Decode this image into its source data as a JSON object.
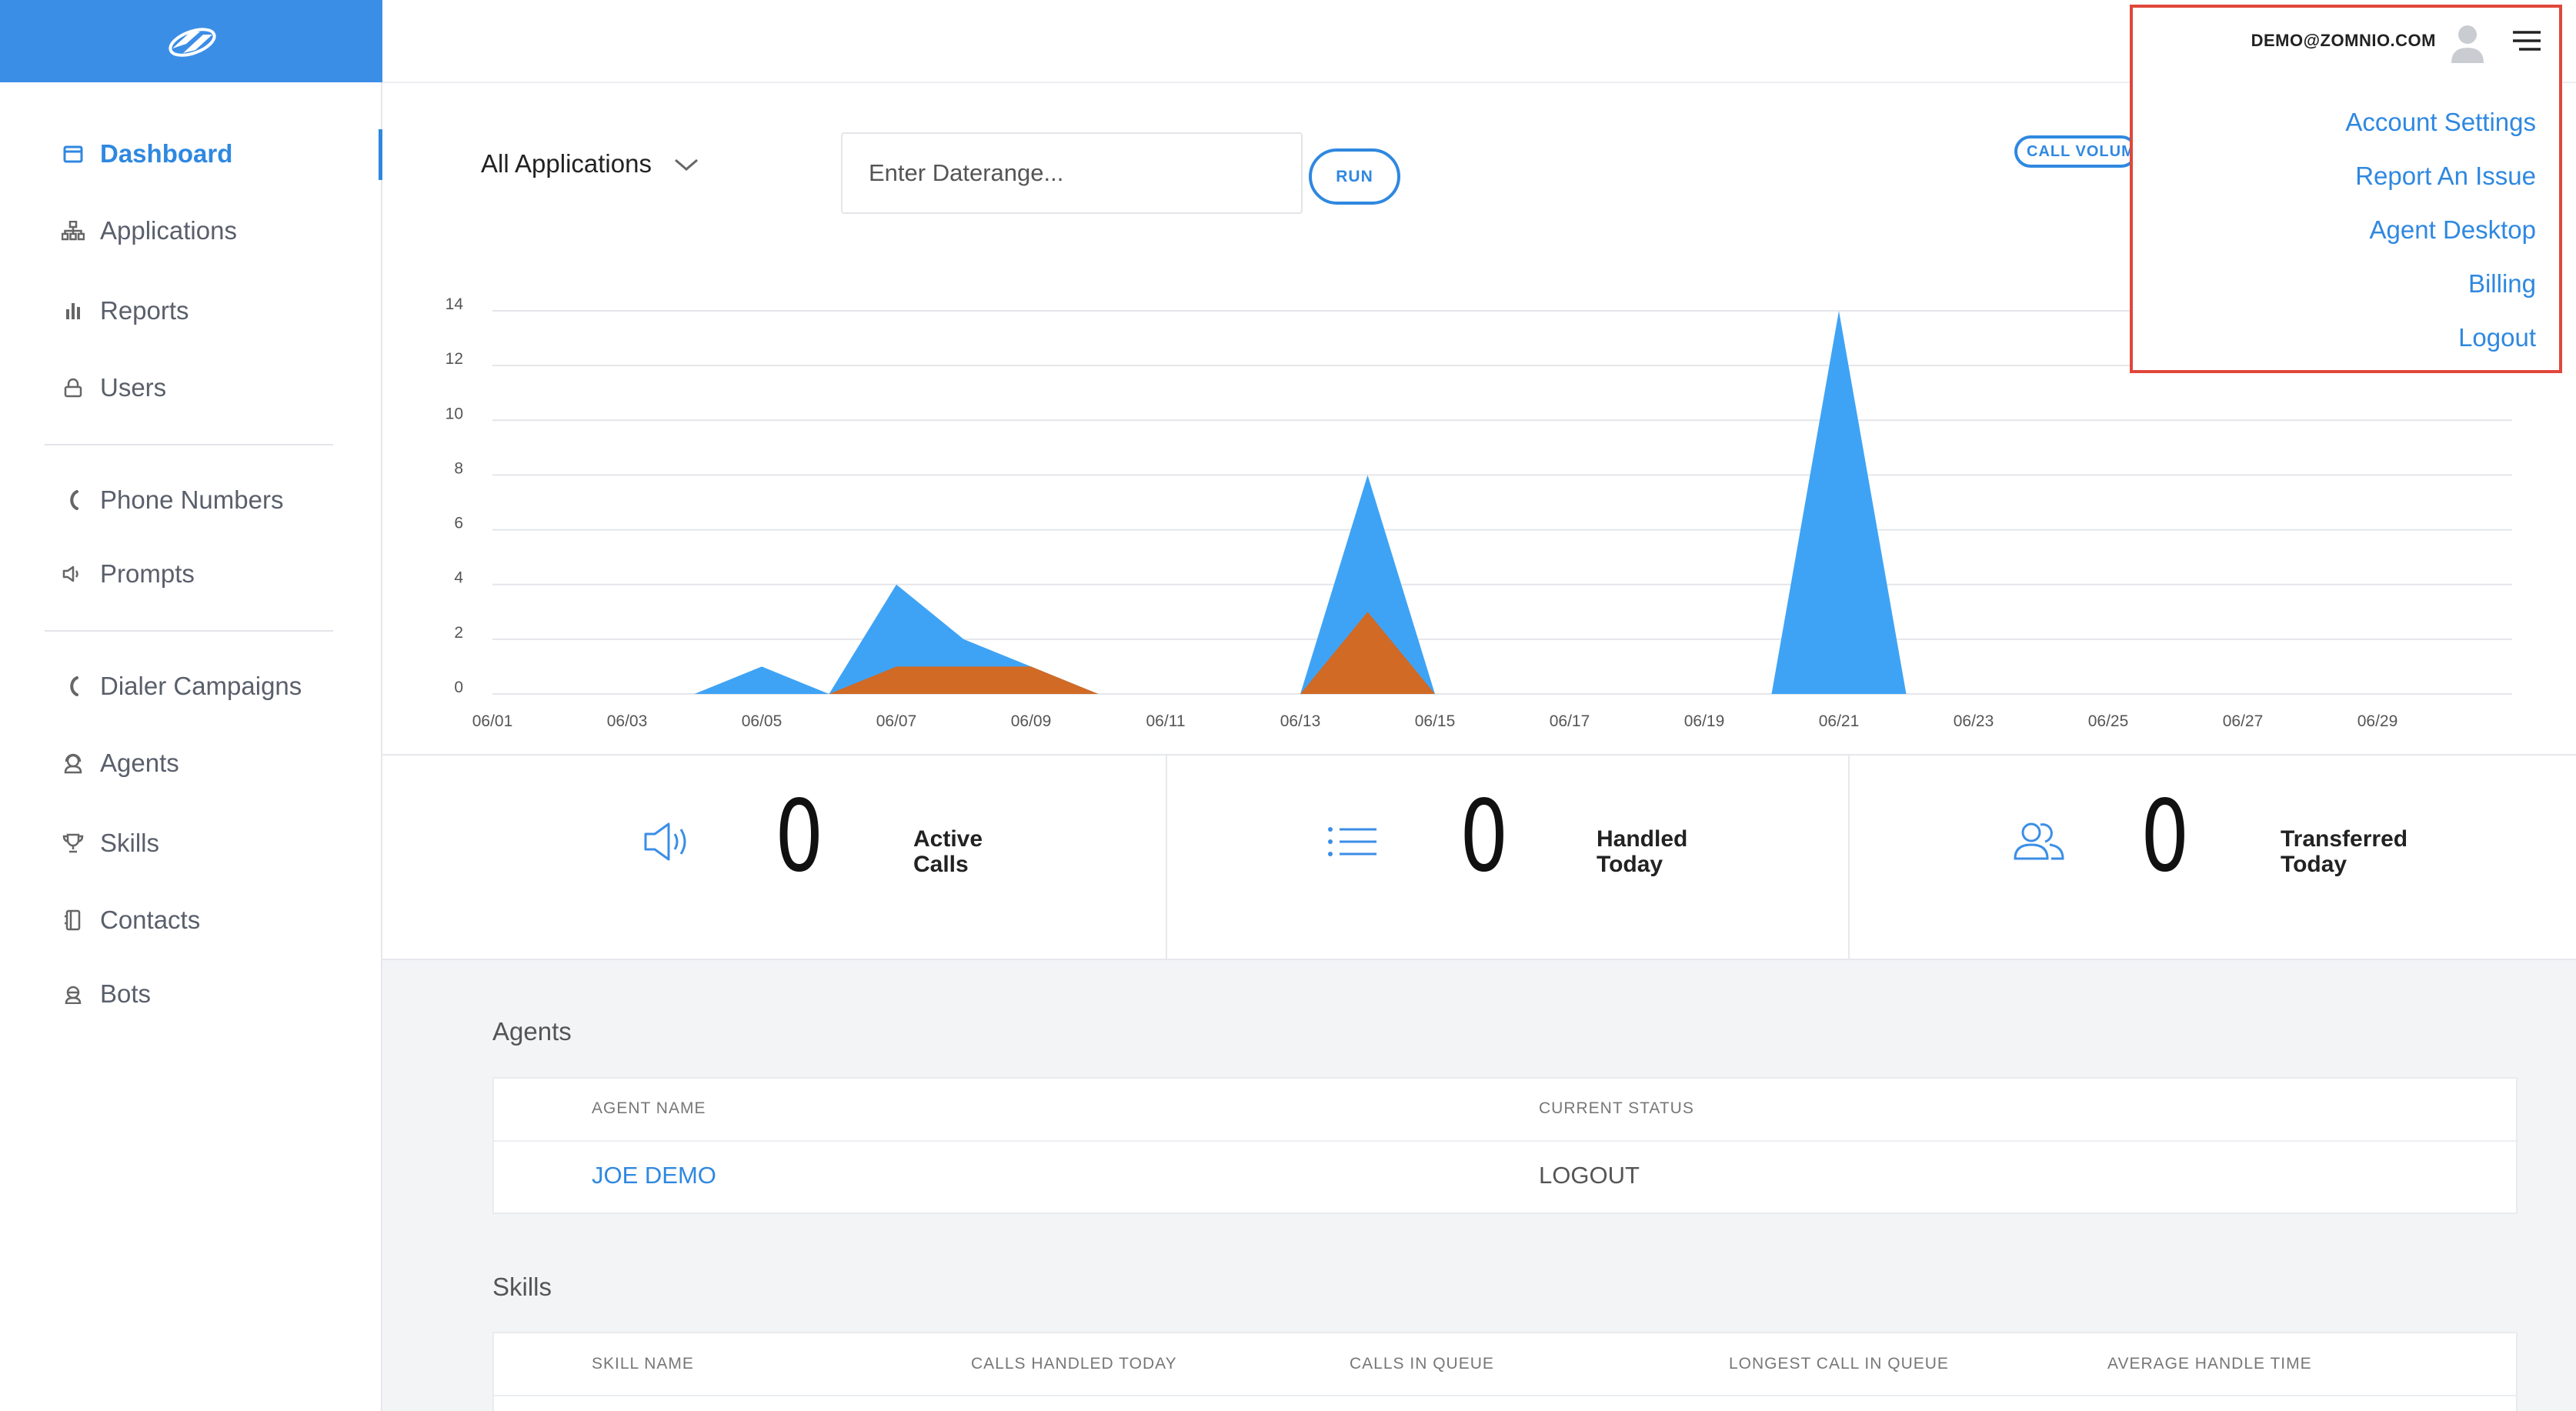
{
  "sidebar": {
    "items": [
      {
        "label": "Dashboard",
        "icon": "calendar-icon"
      },
      {
        "label": "Applications",
        "icon": "sitemap-icon"
      },
      {
        "label": "Reports",
        "icon": "bar-chart-icon"
      },
      {
        "label": "Users",
        "icon": "lock-icon"
      },
      {
        "label": "Phone Numbers",
        "icon": "phone-icon"
      },
      {
        "label": "Prompts",
        "icon": "speaker-icon"
      },
      {
        "label": "Dialer Campaigns",
        "icon": "phone-icon"
      },
      {
        "label": "Agents",
        "icon": "agent-icon"
      },
      {
        "label": "Skills",
        "icon": "trophy-icon"
      },
      {
        "label": "Contacts",
        "icon": "address-book-icon"
      },
      {
        "label": "Bots",
        "icon": "bot-icon"
      }
    ],
    "active_index": 0
  },
  "filters": {
    "application": "All Applications",
    "daterange_placeholder": "Enter Daterange...",
    "run_label": "RUN",
    "call_volume_label": "CALL VOLUM"
  },
  "chart_data": {
    "type": "area",
    "x": [
      "06/01",
      "06/02",
      "06/03",
      "06/04",
      "06/05",
      "06/06",
      "06/07",
      "06/08",
      "06/09",
      "06/10",
      "06/11",
      "06/12",
      "06/13",
      "06/14",
      "06/15",
      "06/16",
      "06/17",
      "06/18",
      "06/19",
      "06/20",
      "06/21",
      "06/22",
      "06/23",
      "06/24",
      "06/25",
      "06/26",
      "06/27",
      "06/28",
      "06/29",
      "06/30",
      "07/01"
    ],
    "x_tick_labels": [
      "06/01",
      "06/03",
      "06/05",
      "06/07",
      "06/09",
      "06/11",
      "06/13",
      "06/15",
      "06/17",
      "06/19",
      "06/21",
      "06/23",
      "06/25",
      "06/27",
      "06/29"
    ],
    "series": [
      {
        "color": "#3fa3f5",
        "values": [
          0,
          0,
          0,
          0,
          1,
          0,
          4,
          2,
          1,
          0,
          0,
          0,
          0,
          8,
          0,
          0,
          0,
          0,
          0,
          0,
          14,
          0,
          0,
          0,
          0,
          0,
          0,
          0,
          0,
          0,
          0
        ]
      },
      {
        "color": "#d06a25",
        "values": [
          0,
          0,
          0,
          0,
          0,
          0,
          1,
          1,
          1,
          0,
          0,
          0,
          0,
          3,
          0,
          0,
          0,
          0,
          0,
          0,
          0,
          0,
          0,
          0,
          0,
          0,
          0,
          0,
          0,
          0,
          0
        ]
      }
    ],
    "yticks": [
      0,
      2,
      4,
      6,
      8,
      10,
      12,
      14
    ],
    "ylim": [
      0,
      14
    ],
    "grid": true
  },
  "stats": [
    {
      "value": "0",
      "label_line1": "Active",
      "label_line2": "Calls",
      "icon": "speaker-icon"
    },
    {
      "value": "0",
      "label_line1": "Handled",
      "label_line2": "Today",
      "icon": "list-icon"
    },
    {
      "value": "0",
      "label_line1": "Transferred",
      "label_line2": "Today",
      "icon": "users-icon"
    }
  ],
  "agents": {
    "title": "Agents",
    "columns": [
      "AGENT NAME",
      "CURRENT STATUS"
    ],
    "rows": [
      {
        "name": "JOE DEMO",
        "status": "LOGOUT"
      }
    ]
  },
  "skills": {
    "title": "Skills",
    "columns": [
      "SKILL NAME",
      "CALLS HANDLED TODAY",
      "CALLS IN QUEUE",
      "LONGEST CALL IN QUEUE",
      "AVERAGE HANDLE TIME"
    ]
  },
  "user_menu": {
    "email": "DEMO@ZOMNIO.COM",
    "items": [
      "Account Settings",
      "Report An Issue",
      "Agent Desktop",
      "Billing",
      "Logout"
    ]
  },
  "colors": {
    "accent": "#2f88e0",
    "brand_bar": "#3b8ee6",
    "series_blue": "#3fa3f5",
    "series_orange": "#d06a25",
    "highlight_border": "#e0473a"
  }
}
